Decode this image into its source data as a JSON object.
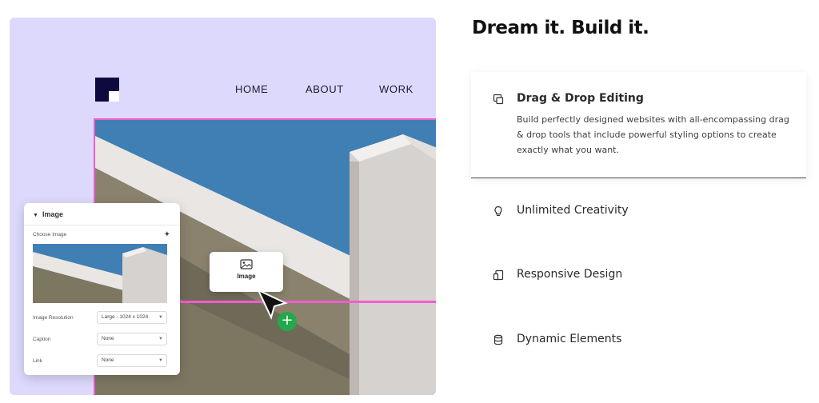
{
  "nav": {
    "items": [
      "HOME",
      "ABOUT",
      "WORK"
    ]
  },
  "drag_card": {
    "label": "Image",
    "icon": "image-icon"
  },
  "panel": {
    "title": "Image",
    "choose_label": "Choose Image",
    "rows": [
      {
        "label": "Image Resolution",
        "value": "Large - 1024 x 1024"
      },
      {
        "label": "Caption",
        "value": "None"
      },
      {
        "label": "Link",
        "value": "None"
      }
    ]
  },
  "content": {
    "heading": "Dream it. Build it.",
    "features": [
      {
        "title": "Drag & Drop Editing",
        "icon": "drag-drop-icon",
        "description": "Build perfectly designed websites with all-encompassing drag & drop tools that include powerful styling options to create exactly what you want.",
        "active": true
      },
      {
        "title": "Unlimited Creativity",
        "icon": "lightbulb-icon",
        "active": false
      },
      {
        "title": "Responsive Design",
        "icon": "responsive-icon",
        "active": false
      },
      {
        "title": "Dynamic Elements",
        "icon": "database-icon",
        "active": false
      }
    ]
  },
  "colors": {
    "showcase_bg": "#ddd9fd",
    "accent_pink": "#f25ccf",
    "plus_green": "#22a94b",
    "logo_navy": "#0e0a3e"
  }
}
